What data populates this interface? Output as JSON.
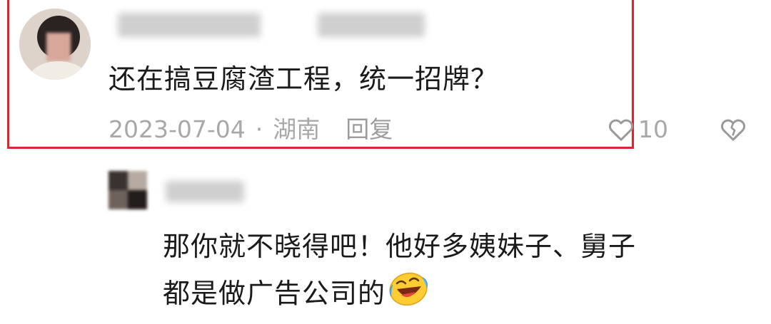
{
  "comment": {
    "text": "还在搞豆腐渣工程，统一招牌？",
    "date": "2023-07-04",
    "separator": "·",
    "location": "湖南",
    "reply_label": "回复",
    "like_count": "10"
  },
  "reply": {
    "line1": "那你就不晓得吧！他好多姨妹子、舅子",
    "line2": "都是做广告公司的"
  },
  "colors": {
    "highlight": "#e0242f",
    "meta_text": "#a8a8a8",
    "body_text": "#1a1a1a"
  },
  "icons": {
    "like": "heart-outline-icon",
    "dislike": "broken-heart-icon",
    "emoji": "laughing-crying-emoji-icon"
  }
}
